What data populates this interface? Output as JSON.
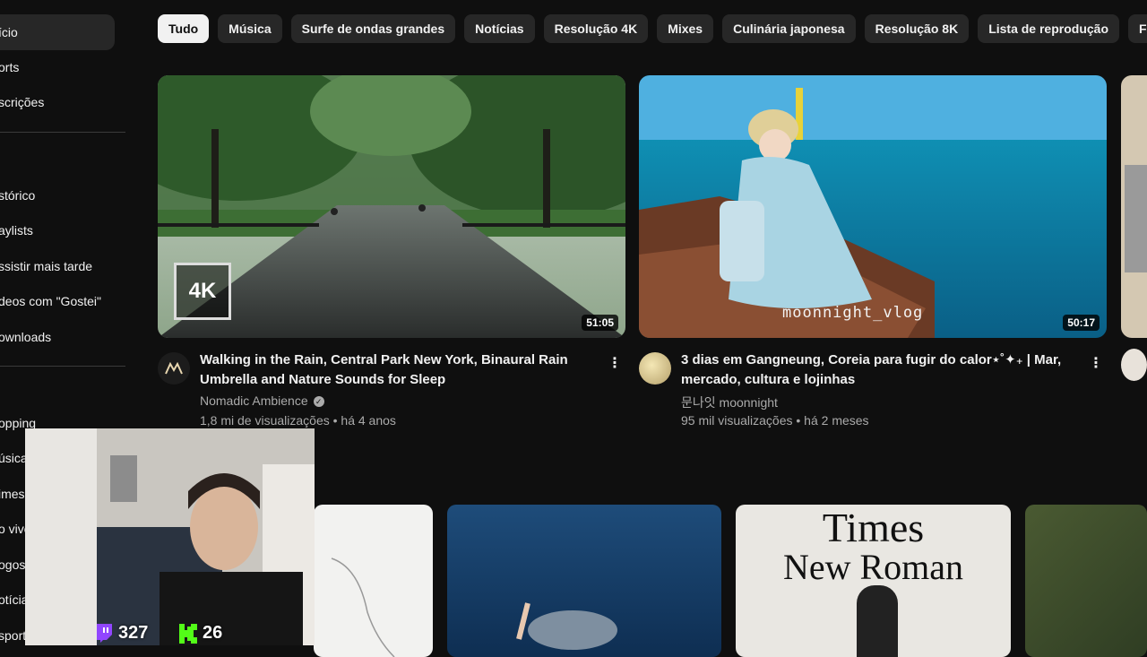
{
  "sidebar": {
    "items": [
      {
        "label": "ício",
        "active": true
      },
      {
        "label": "orts"
      },
      {
        "label": "scrições"
      },
      {
        "label": "stórico"
      },
      {
        "label": "aylists"
      },
      {
        "label": "ssistir mais tarde"
      },
      {
        "label": "deos com \"Gostei\""
      },
      {
        "label": "ownloads"
      },
      {
        "label": "opping"
      },
      {
        "label": "úsica"
      },
      {
        "label": "imes"
      },
      {
        "label": "o vivo"
      },
      {
        "label": "ogos"
      },
      {
        "label": "otícia"
      },
      {
        "label": "sporte"
      }
    ]
  },
  "chips": [
    "Tudo",
    "Música",
    "Surfe de ondas grandes",
    "Notícias",
    "Resolução 4K",
    "Mixes",
    "Culinária japonesa",
    "Resolução 8K",
    "Lista de reprodução",
    "Fantasia"
  ],
  "videos": [
    {
      "title": "Walking in the Rain, Central Park New York, Binaural Rain Umbrella and Nature Sounds for Sleep",
      "channel": "Nomadic Ambience",
      "verified": true,
      "stats": "1,8 mi de visualizações • há 4 anos",
      "duration": "51:05",
      "badge": "4K"
    },
    {
      "title": "3 dias em Gangneung, Coreia para fugir do calor⋆˚✦₊ | Mar, mercado, cultura e lojinhas",
      "channel": "문나잇 moonnight",
      "stats": "95 mil visualizações • há 2 meses",
      "duration": "50:17",
      "watermark": "moonnight_vlog"
    }
  ],
  "row2": {
    "font_card_text": [
      "Times",
      "New Roman"
    ]
  },
  "stream_stats": {
    "twitch_viewers": "327",
    "kick_viewers": "26"
  },
  "colors": {
    "background": "#0f0f0f",
    "chip": "#272727",
    "chip_selected": "#f1f1f1",
    "twitch": "#9146ff",
    "kick": "#53fc18"
  }
}
